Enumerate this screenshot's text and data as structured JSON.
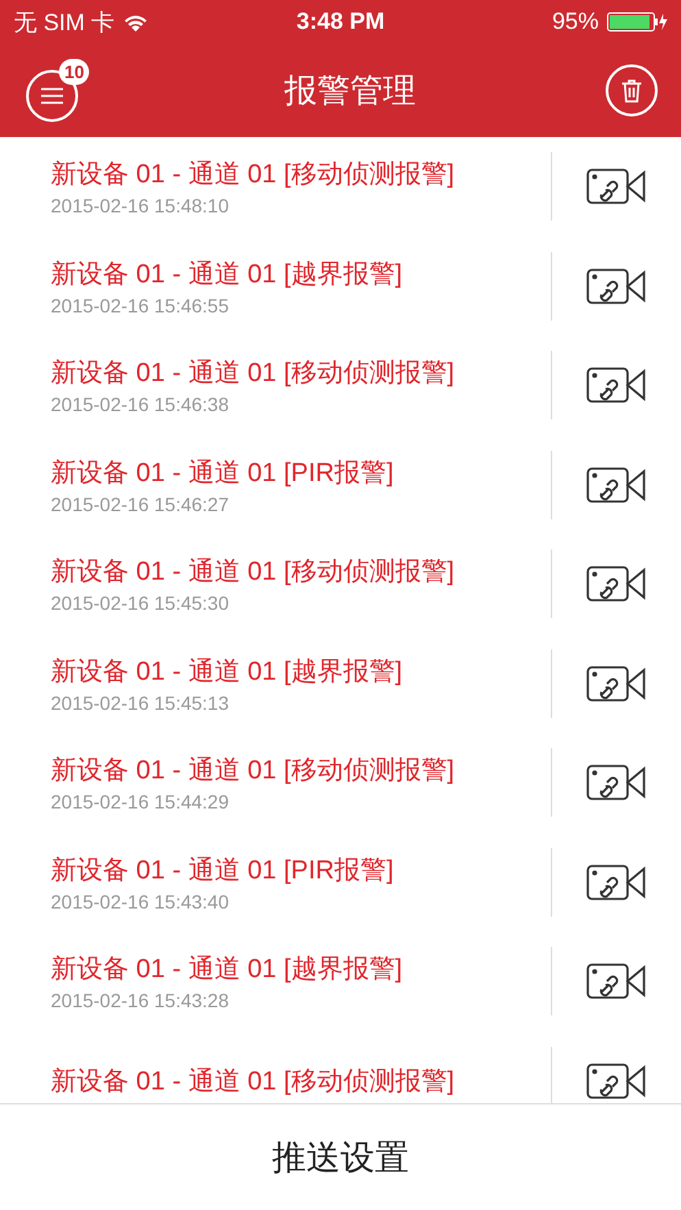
{
  "status_bar": {
    "carrier": "无 SIM 卡",
    "time": "3:48 PM",
    "battery": "95%"
  },
  "nav": {
    "title": "报警管理",
    "badge": "10"
  },
  "alarms": [
    {
      "title": "新设备 01 - 通道 01 [移动侦测报警]",
      "time": "2015-02-16 15:48:10"
    },
    {
      "title": "新设备 01 - 通道 01 [越界报警]",
      "time": "2015-02-16 15:46:55"
    },
    {
      "title": "新设备 01 - 通道 01 [移动侦测报警]",
      "time": "2015-02-16 15:46:38"
    },
    {
      "title": "新设备 01 - 通道 01 [PIR报警]",
      "time": "2015-02-16 15:46:27"
    },
    {
      "title": "新设备 01 - 通道 01 [移动侦测报警]",
      "time": "2015-02-16 15:45:30"
    },
    {
      "title": "新设备 01 - 通道 01 [越界报警]",
      "time": "2015-02-16 15:45:13"
    },
    {
      "title": "新设备 01 - 通道 01 [移动侦测报警]",
      "time": "2015-02-16 15:44:29"
    },
    {
      "title": "新设备 01 - 通道 01 [PIR报警]",
      "time": "2015-02-16 15:43:40"
    },
    {
      "title": "新设备 01 - 通道 01 [越界报警]",
      "time": "2015-02-16 15:43:28"
    },
    {
      "title": "新设备 01 - 通道 01 [移动侦测报警]"
    }
  ],
  "footer": {
    "label": "推送设置"
  }
}
